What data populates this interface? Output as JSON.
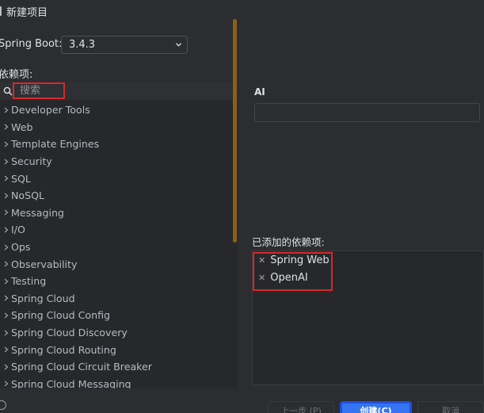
{
  "window": {
    "title": "新建项目"
  },
  "spring_boot": {
    "label": "Spring Boot:",
    "version": "3.4.3"
  },
  "dependencies": {
    "label": "依赖项:",
    "search_placeholder": "搜索",
    "categories": [
      "Developer Tools",
      "Web",
      "Template Engines",
      "Security",
      "SQL",
      "NoSQL",
      "Messaging",
      "I/O",
      "Ops",
      "Observability",
      "Testing",
      "Spring Cloud",
      "Spring Cloud Config",
      "Spring Cloud Discovery",
      "Spring Cloud Routing",
      "Spring Cloud Circuit Breaker",
      "Spring Cloud Messaging"
    ]
  },
  "detail": {
    "title": "AI"
  },
  "added": {
    "label": "已添加的依赖项:",
    "items": [
      "Spring Web",
      "OpenAI"
    ]
  },
  "buttons": {
    "prev": "上一步 (P)",
    "create": "创建(C)",
    "cancel": "取消"
  },
  "colors": {
    "highlight_red": "#d42a2a",
    "primary_blue": "#3574f0",
    "scrollbar": "#8a5f1c"
  }
}
